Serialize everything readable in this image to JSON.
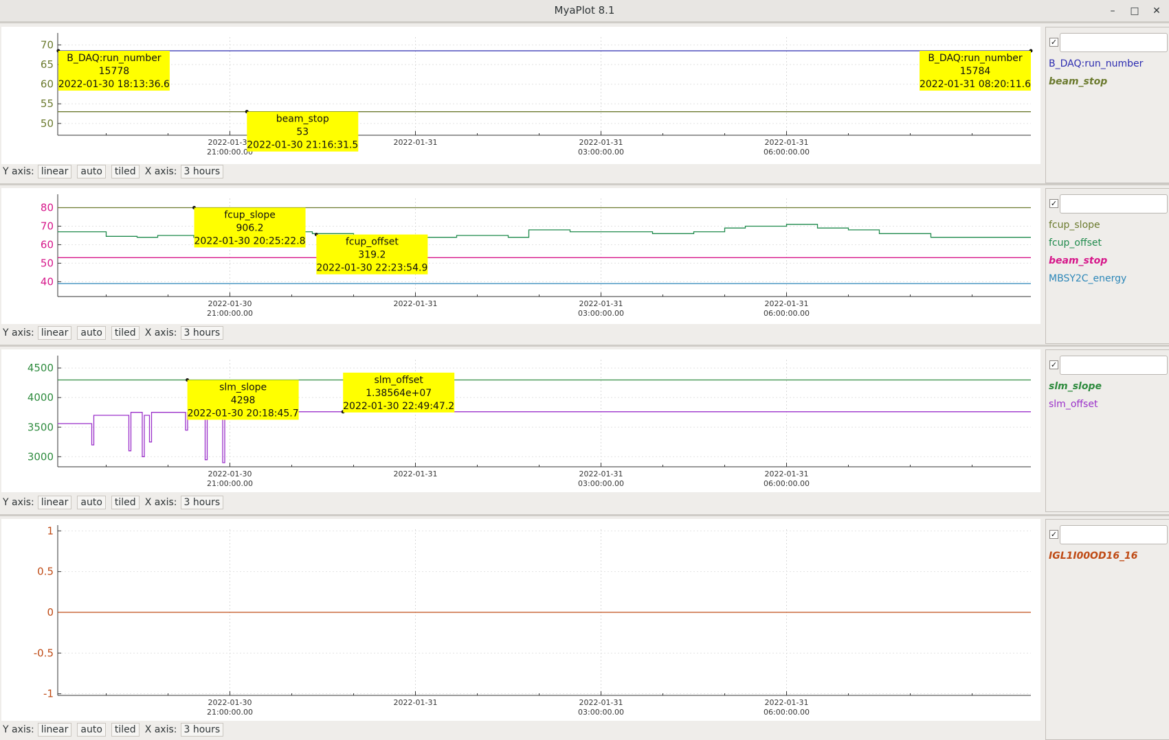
{
  "window": {
    "title": "MyaPlot 8.1"
  },
  "controls": {
    "y_axis_label": "Y axis:",
    "scale": "linear",
    "range": "auto",
    "layout": "tiled",
    "x_axis_label": "X axis:",
    "span": "3 hours"
  },
  "x_axis": {
    "domain": [
      "2022-01-30 18:13:00",
      "2022-01-31 09:57:00"
    ],
    "ticks": [
      {
        "t": "2022-01-30 21:00:00",
        "date": "2022-01-30",
        "time": "21:00:00.00"
      },
      {
        "t": "2022-01-31 00:00:00",
        "date": "2022-01-31",
        "time": ""
      },
      {
        "t": "2022-01-31 03:00:00",
        "date": "2022-01-31",
        "time": "03:00:00.00"
      },
      {
        "t": "2022-01-31 06:00:00",
        "date": "2022-01-31",
        "time": "06:00:00.00"
      }
    ]
  },
  "colors": {
    "run_number": "#2b2bb0",
    "beam_stop_olive": "#6b7a2e",
    "fcup_slope": "#6b7a2e",
    "fcup_offset": "#1f8a4c",
    "beam_stop_pink": "#d6178a",
    "mbsy2c": "#2b86b8",
    "slm_slope": "#2e8b3e",
    "slm_offset": "#9a2fc9",
    "igl": "#bf4a14",
    "tooltip": "#ffff00"
  },
  "chart_data": [
    {
      "type": "line",
      "ylim": [
        47,
        72
      ],
      "yticks": [
        50,
        55,
        60,
        65,
        70
      ],
      "tick_color": "#6b7a2e",
      "series": [
        {
          "name": "B_DAQ:run_number",
          "style": "normal",
          "color": "#2b2bb0",
          "x": [
            "2022-01-30 18:13:36",
            "2022-01-31 09:57:00"
          ],
          "y": [
            68.5,
            68.5
          ]
        },
        {
          "name": "beam_stop",
          "style": "bold-italic",
          "color": "#6b7a2e",
          "x": [
            "2022-01-30 18:13:00",
            "2022-01-31 09:57:00"
          ],
          "y": [
            53,
            53
          ]
        }
      ],
      "annotations": [
        {
          "name": "B_DAQ:run_number",
          "value": "15778",
          "time": "2022-01-30 18:13:36.6",
          "t": "2022-01-30 18:13:36",
          "y": 68.5
        },
        {
          "name": "beam_stop",
          "value": "53",
          "time": "2022-01-30 21:16:31.5",
          "t": "2022-01-30 21:16:31",
          "y": 53
        },
        {
          "name": "B_DAQ:run_number",
          "value": "15784",
          "time": "2022-01-31 08:20:11.6",
          "t": "2022-01-31 09:57:00",
          "y": 68.5
        }
      ]
    },
    {
      "type": "line",
      "ylim": [
        32,
        85
      ],
      "yticks": [
        40,
        50,
        60,
        70,
        80
      ],
      "tick_color": "#d6178a",
      "series": [
        {
          "name": "fcup_slope",
          "style": "normal",
          "color": "#6b7a2e",
          "x": [
            "2022-01-30 18:13:00",
            "2022-01-31 09:57:00"
          ],
          "y": [
            80,
            80
          ]
        },
        {
          "name": "fcup_offset",
          "style": "normal",
          "color": "#1f8a4c",
          "x": [
            "2022-01-30 18:13:00",
            "2022-01-30 18:40:00",
            "2022-01-30 19:00:00",
            "2022-01-30 19:30:00",
            "2022-01-30 19:50:00",
            "2022-01-30 20:25:00",
            "2022-01-30 21:00:00",
            "2022-01-30 21:40:00",
            "2022-01-30 22:20:00",
            "2022-01-30 23:00:00",
            "2022-01-31 00:00:00",
            "2022-01-31 00:40:00",
            "2022-01-31 01:30:00",
            "2022-01-31 01:50:00",
            "2022-01-31 02:30:00",
            "2022-01-31 03:10:00",
            "2022-01-31 03:50:00",
            "2022-01-31 04:30:00",
            "2022-01-31 05:00:00",
            "2022-01-31 05:20:00",
            "2022-01-31 06:00:00",
            "2022-01-31 06:30:00",
            "2022-01-31 07:00:00",
            "2022-01-31 07:30:00",
            "2022-01-31 08:20:00",
            "2022-01-31 09:00:00",
            "2022-01-31 09:57:00"
          ],
          "y": [
            67,
            67,
            64.5,
            64,
            65,
            64,
            67,
            67,
            66,
            65,
            64,
            65,
            64,
            68,
            67,
            67,
            66,
            67,
            69,
            70,
            71,
            69,
            68,
            66,
            64,
            64,
            64
          ]
        },
        {
          "name": "beam_stop",
          "style": "bold-italic",
          "color": "#d6178a",
          "x": [
            "2022-01-30 18:13:00",
            "2022-01-31 09:57:00"
          ],
          "y": [
            53,
            53
          ]
        },
        {
          "name": "MBSY2C_energy",
          "style": "normal",
          "color": "#2b86b8",
          "x": [
            "2022-01-30 18:13:00",
            "2022-01-31 09:57:00"
          ],
          "y": [
            39,
            39
          ]
        }
      ],
      "annotations": [
        {
          "name": "fcup_slope",
          "value": "906.2",
          "time": "2022-01-30 20:25:22.8",
          "t": "2022-01-30 20:25:22",
          "y": 80
        },
        {
          "name": "fcup_offset",
          "value": "319.2",
          "time": "2022-01-30 22:23:54.9",
          "t": "2022-01-30 22:23:54",
          "y": 65.5
        }
      ]
    },
    {
      "type": "line",
      "ylim": [
        2830,
        4640
      ],
      "yticks": [
        3000,
        3500,
        4000,
        4500
      ],
      "tick_color": "#2e8b3e",
      "series": [
        {
          "name": "slm_slope",
          "style": "bold-italic",
          "color": "#2e8b3e",
          "x": [
            "2022-01-30 18:13:00",
            "2022-01-31 09:57:00"
          ],
          "y": [
            4298,
            4298
          ]
        },
        {
          "name": "slm_offset",
          "style": "normal",
          "color": "#9a2fc9",
          "x": [
            "2022-01-30 18:13:00",
            "2022-01-30 18:40:00",
            "2022-01-30 18:46:00",
            "2022-01-30 18:48:00",
            "2022-01-30 19:20:00",
            "2022-01-30 19:22:00",
            "2022-01-30 19:24:00",
            "2022-01-30 19:33:00",
            "2022-01-30 19:35:00",
            "2022-01-30 19:37:00",
            "2022-01-30 19:40:00",
            "2022-01-30 19:42:00",
            "2022-01-30 19:44:00",
            "2022-01-30 20:15:00",
            "2022-01-30 20:17:00",
            "2022-01-30 20:19:00",
            "2022-01-30 20:35:00",
            "2022-01-30 20:36:00",
            "2022-01-30 20:38:00",
            "2022-01-30 20:52:00",
            "2022-01-30 20:53:00",
            "2022-01-30 20:55:00",
            "2022-01-30 22:00:00",
            "2022-01-31 09:57:00"
          ],
          "y": [
            3560,
            3560,
            3200,
            3700,
            3700,
            3100,
            3750,
            3750,
            3000,
            3700,
            3700,
            3250,
            3750,
            3750,
            3450,
            3750,
            3750,
            2950,
            3750,
            3750,
            2900,
            3760,
            3760,
            3760
          ]
        }
      ],
      "annotations": [
        {
          "name": "slm_slope",
          "value": "4298",
          "time": "2022-01-30 20:18:45.7",
          "t": "2022-01-30 20:18:45",
          "y": 4298
        },
        {
          "name": "slm_offset",
          "value": "1.38564e+07",
          "time": "2022-01-30 22:49:47.2",
          "t": "2022-01-30 22:49:47",
          "y": 3760
        }
      ]
    },
    {
      "type": "line",
      "ylim": [
        -1.02,
        1.02
      ],
      "yticks": [
        -1,
        -0.5,
        0,
        0.5,
        1
      ],
      "tick_color": "#bf4a14",
      "series": [
        {
          "name": "IGL1I00OD16_16",
          "style": "bold-italic",
          "color": "#bf4a14",
          "x": [
            "2022-01-30 18:13:00",
            "2022-01-31 09:57:00"
          ],
          "y": [
            0,
            0
          ]
        }
      ],
      "annotations": []
    }
  ]
}
